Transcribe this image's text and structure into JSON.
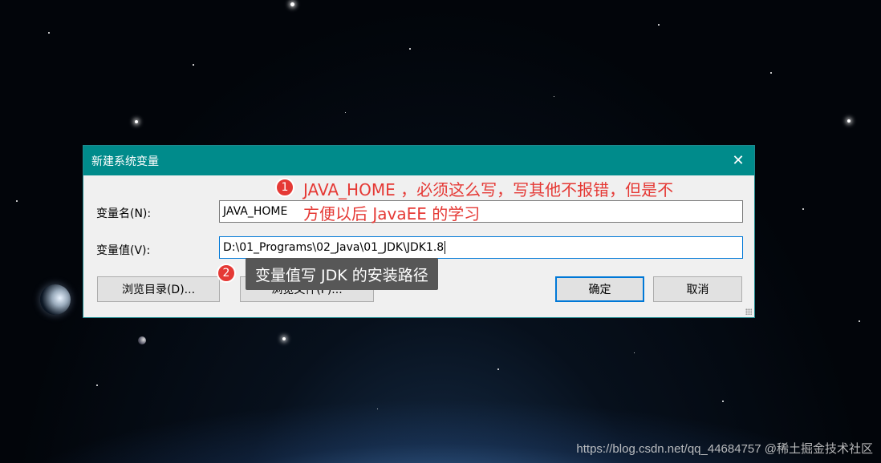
{
  "dialog": {
    "title": "新建系统变量",
    "name_label": "变量名(N):",
    "name_value": "JAVA_HOME",
    "value_label": "变量值(V):",
    "value_value": "D:\\01_Programs\\02_Java\\01_JDK\\JDK1.8",
    "browse_dir_label": "浏览目录(D)...",
    "browse_file_label": "浏览文件(F)...",
    "ok_label": "确定",
    "cancel_label": "取消",
    "close_icon": "close-icon",
    "accent_color": "#008b8b"
  },
  "annotations": {
    "badge1": "1",
    "note1_line1": "JAVA_HOME ，必须这么写，写其他不报错，但是不",
    "note1_line2": "方便以后 JavaEE 的学习",
    "badge2": "2",
    "note2": "变量值写 JDK 的安装路径",
    "badge_color": "#e53935"
  },
  "watermark": "https://blog.csdn.net/qq_44684757 @稀土掘金技术社区"
}
